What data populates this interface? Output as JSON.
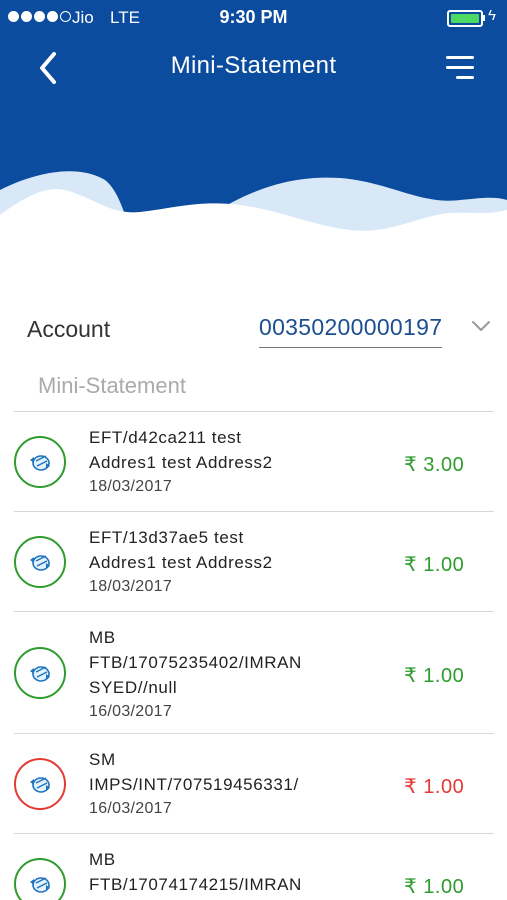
{
  "status_bar": {
    "carrier": "Jio",
    "network": "LTE",
    "time": "9:30 PM",
    "battery_level": 1.0,
    "battery_color": "#4cd964"
  },
  "header": {
    "title": "Mini-Statement",
    "back_icon": "chevron-left-icon",
    "menu_icon": "hamburger-menu-icon",
    "background_color": "#0b4c9e"
  },
  "account": {
    "label": "Account",
    "selected": "00350200000197",
    "dropdown_icon": "chevron-down-icon"
  },
  "section_title": "Mini-Statement",
  "colors": {
    "credit": "#2e9c2e",
    "debit": "#e53935"
  },
  "transactions": [
    {
      "description": "EFT/d42ca211 test\nAddres1 test Address2",
      "date": "18/03/2017",
      "amount": "₹ 3.00",
      "type": "credit"
    },
    {
      "description": "EFT/13d37ae5 test\nAddres1 test Address2",
      "date": "18/03/2017",
      "amount": "₹ 1.00",
      "type": "credit"
    },
    {
      "description": "MB\nFTB/17075235402/IMRAN\nSYED//null",
      "date": "16/03/2017",
      "amount": "₹ 1.00",
      "type": "credit"
    },
    {
      "description": "SM\nIMPS/INT/707519456331/",
      "date": "16/03/2017",
      "amount": "₹ 1.00",
      "type": "debit"
    },
    {
      "description": "MB\nFTB/17074174215/IMRAN",
      "date": "",
      "amount": "₹ 1.00",
      "type": "credit"
    }
  ]
}
